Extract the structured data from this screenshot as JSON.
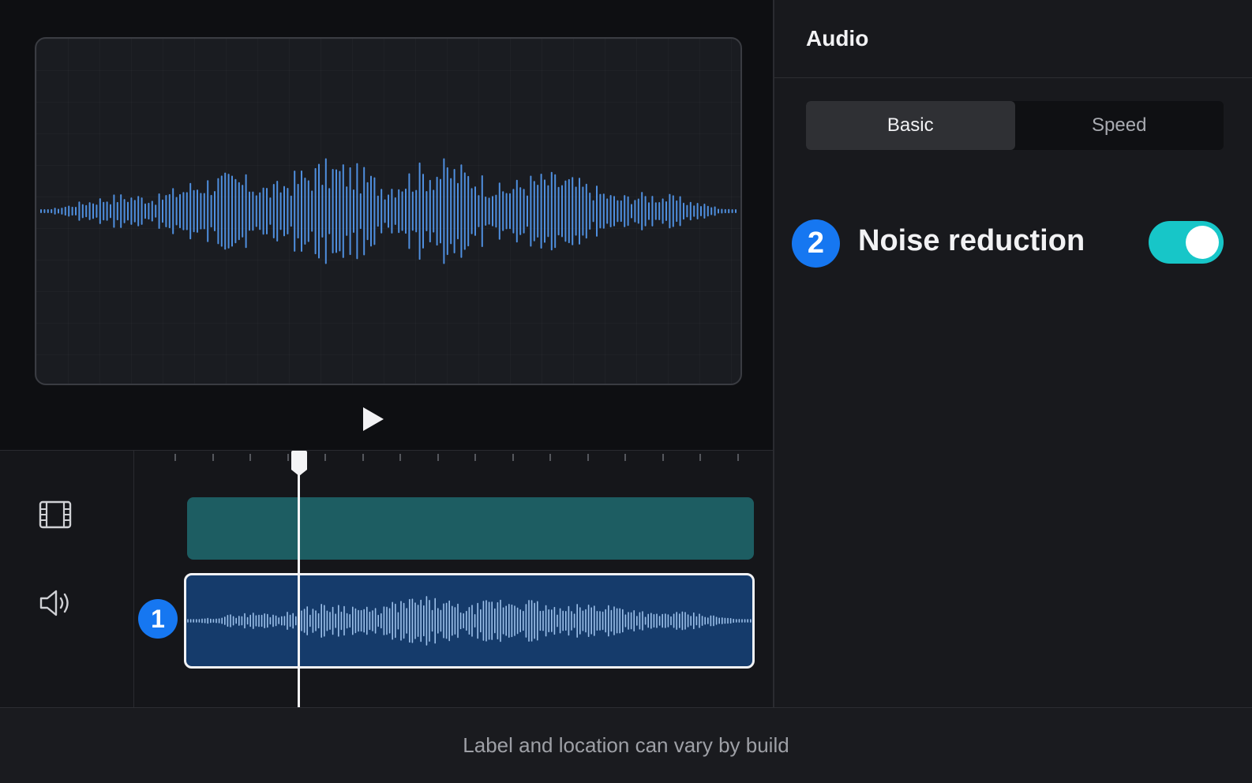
{
  "preview": {
    "play_icon": "play-icon",
    "waveform_color": "#4f8fdf"
  },
  "timeline": {
    "video_track_icon": "film-icon",
    "audio_track_icon": "speaker-icon",
    "video_clip_color": "#1d5d62",
    "audio_clip_color": "#153b6b"
  },
  "callouts": {
    "step1": "1",
    "step2": "2",
    "color": "#1677f1"
  },
  "panel": {
    "title": "Audio",
    "tabs": [
      {
        "label": "Basic",
        "active": true
      },
      {
        "label": "Speed",
        "active": false
      }
    ],
    "noise_reduction": {
      "label": "Noise reduction",
      "enabled": true,
      "accent": "#17c6c8"
    }
  },
  "footer": {
    "note": "Label and location can vary by build"
  }
}
